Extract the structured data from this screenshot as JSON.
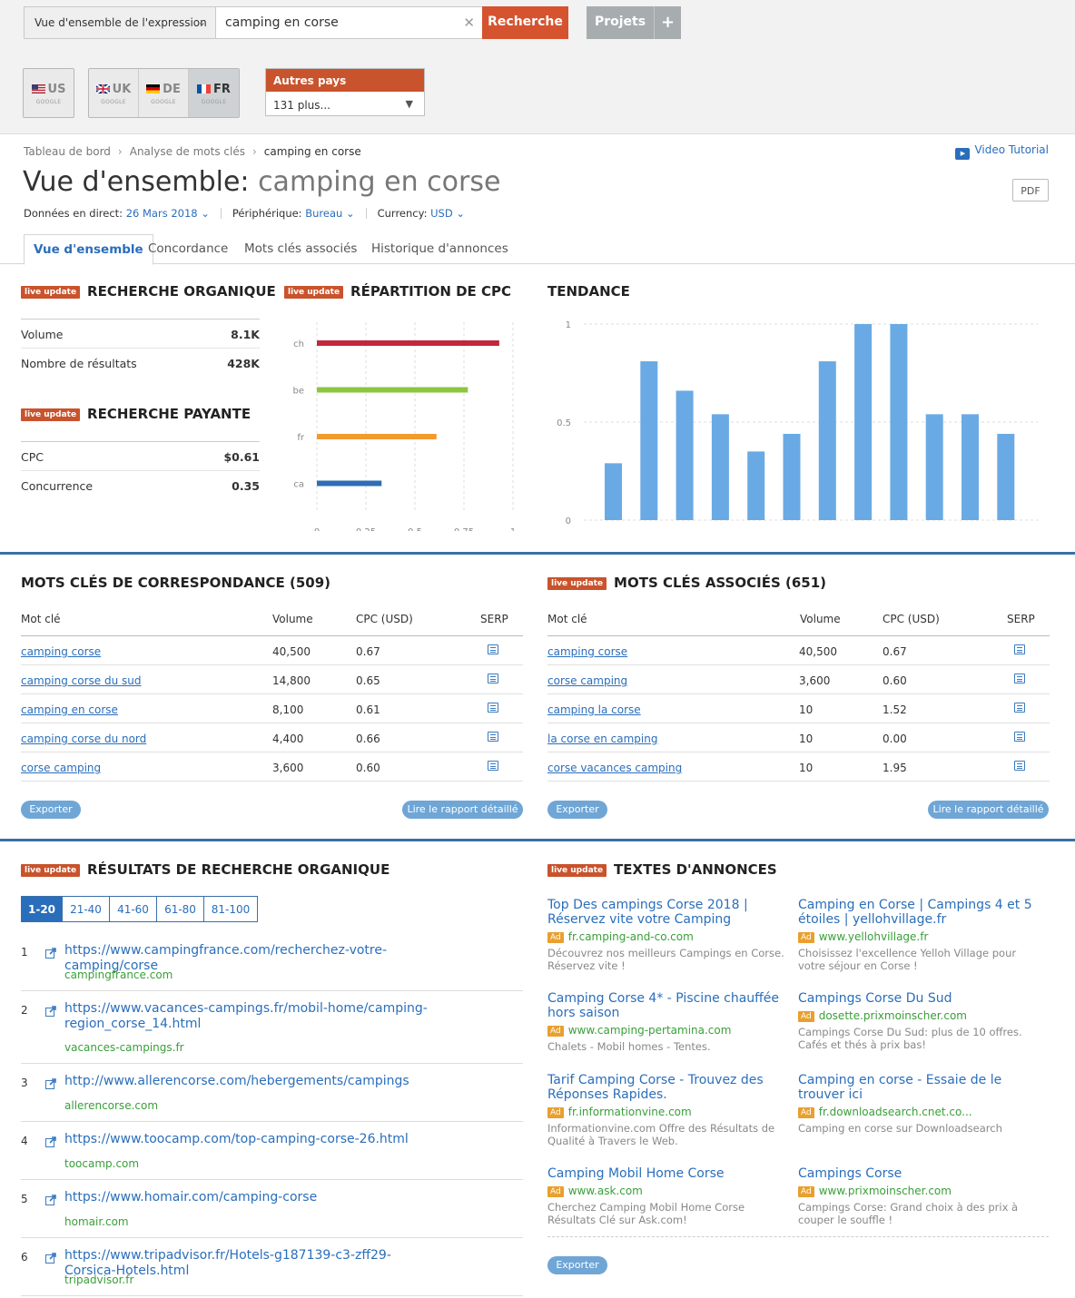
{
  "search": {
    "type_label": "Vue d'ensemble de l'expression",
    "query": "camping en corse",
    "search_btn": "Recherche",
    "projects_btn": "Projets",
    "add": "+"
  },
  "databases": {
    "us": "US",
    "uk": "UK",
    "de": "DE",
    "fr": "FR",
    "engine": "GOOGLE",
    "other_title": "Autres pays",
    "other_value": "131 plus..."
  },
  "breadcrumb": {
    "item1": "Tableau de bord",
    "item2": "Analyse de mots clés",
    "item3": "camping en corse"
  },
  "video_tutorial": "Video Tutorial",
  "page": {
    "title_prefix": "Vue d'ensemble:",
    "title_kw": "camping en corse",
    "pdf": "PDF"
  },
  "meta": {
    "live_label": "Données en direct:",
    "date": "26 Mars 2018",
    "device_label": "Périphérique:",
    "device": "Bureau",
    "currency_label": "Currency:",
    "currency": "USD"
  },
  "tabs": [
    "Vue d'ensemble",
    "Concordance",
    "Mots clés associés",
    "Historique d'annonces"
  ],
  "live_update": "live update",
  "organic": {
    "title": "RECHERCHE ORGANIQUE",
    "volume_label": "Volume",
    "volume": "8.1K",
    "results_label": "Nombre de résultats",
    "results": "428K"
  },
  "paid": {
    "title": "RECHERCHE PAYANTE",
    "cpc_label": "CPC",
    "cpc": "$0.61",
    "comp_label": "Concurrence",
    "comp": "0.35"
  },
  "cpc_dist": {
    "title": "RÉPARTITION DE CPC"
  },
  "trend": {
    "title": "TENDANCE"
  },
  "chart_data": [
    {
      "type": "bar",
      "orientation": "horizontal",
      "title": "RÉPARTITION DE CPC",
      "categories": [
        "ch",
        "be",
        "fr",
        "ca"
      ],
      "values": [
        0.93,
        0.77,
        0.61,
        0.33
      ],
      "colors": [
        "#c0283c",
        "#8cc63f",
        "#f39a2f",
        "#2f6db5"
      ],
      "xlim": [
        0,
        1
      ],
      "ticks": [
        "0",
        "0.25",
        "0.5",
        "0.75",
        "1"
      ]
    },
    {
      "type": "bar",
      "title": "TENDANCE",
      "values": [
        0.29,
        0.81,
        0.66,
        0.54,
        0.35,
        0.44,
        0.81,
        1.0,
        1.0,
        0.54,
        0.54,
        0.44
      ],
      "ylim": [
        0,
        1
      ],
      "ticks": [
        "1",
        "0.5",
        "0"
      ],
      "color": "#6aaae4"
    }
  ],
  "match": {
    "title": "MOTS CLÉS DE CORRESPONDANCE (509)",
    "cols": [
      "Mot clé",
      "Volume",
      "CPC (USD)",
      "SERP"
    ],
    "rows": [
      [
        "camping corse",
        "40,500",
        "0.67"
      ],
      [
        "camping corse du sud",
        "14,800",
        "0.65"
      ],
      [
        "camping en corse",
        "8,100",
        "0.61"
      ],
      [
        "camping corse du nord",
        "4,400",
        "0.66"
      ],
      [
        "corse camping",
        "3,600",
        "0.60"
      ]
    ],
    "export": "Exporter",
    "report": "Lire le rapport détaillé"
  },
  "related": {
    "title": "MOTS CLÉS ASSOCIÉS (651)",
    "cols": [
      "Mot clé",
      "Volume",
      "CPC (USD)",
      "SERP"
    ],
    "rows": [
      [
        "camping corse",
        "40,500",
        "0.67"
      ],
      [
        "corse camping",
        "3,600",
        "0.60"
      ],
      [
        "camping la corse",
        "10",
        "1.52"
      ],
      [
        "la corse en camping",
        "10",
        "0.00"
      ],
      [
        "corse vacances camping",
        "10",
        "1.95"
      ]
    ],
    "export": "Exporter",
    "report": "Lire le rapport détaillé"
  },
  "organic_results": {
    "title": "RÉSULTATS DE RECHERCHE ORGANIQUE",
    "pages": [
      "1-20",
      "21-40",
      "41-60",
      "61-80",
      "81-100"
    ],
    "items": [
      {
        "n": "1",
        "url": "https://www.campingfrance.com/recherchez-votre-camping/corse",
        "domain": "campingfrance.com"
      },
      {
        "n": "2",
        "url": "https://www.vacances-campings.fr/mobil-home/camping-region_corse_14.html",
        "domain": "vacances-campings.fr"
      },
      {
        "n": "3",
        "url": "http://www.allerencorse.com/hebergements/campings",
        "domain": "allerencorse.com"
      },
      {
        "n": "4",
        "url": "https://www.toocamp.com/top-camping-corse-26.html",
        "domain": "toocamp.com"
      },
      {
        "n": "5",
        "url": "https://www.homair.com/camping-corse",
        "domain": "homair.com"
      },
      {
        "n": "6",
        "url": "https://www.tripadvisor.fr/Hotels-g187139-c3-zff29-Corsica-Hotels.html",
        "domain": "tripadvisor.fr"
      }
    ]
  },
  "ads": {
    "title": "TEXTES D'ANNONCES",
    "tag": "Ad",
    "export": "Exporter",
    "items": [
      {
        "title": "Top Des campings Corse 2018 | Réservez vite votre Camping",
        "url": "fr.camping-and-co.com",
        "desc": "Découvrez nos meilleurs Campings en Corse. Réservez vite !"
      },
      {
        "title": "Camping en Corse | Campings 4 et 5 étoiles | yellohvillage.fr",
        "url": "www.yellohvillage.fr",
        "desc": "Choisissez l'excellence Yelloh Village pour votre séjour en Corse !"
      },
      {
        "title": "Camping Corse 4* - Piscine chauffée hors saison",
        "url": "www.camping-pertamina.com",
        "desc": "Chalets - Mobil homes - Tentes."
      },
      {
        "title": "Campings Corse Du Sud",
        "url": "dosette.prixmoinscher.com",
        "desc": "Campings Corse Du Sud: plus de 10 offres. Cafés et thés à prix bas!"
      },
      {
        "title": "Tarif Camping Corse - Trouvez des Réponses Rapides.",
        "url": "fr.informationvine.com",
        "desc": "Informationvine.com Offre des Résultats de Qualité à Travers le Web."
      },
      {
        "title": "Camping en corse - Essaie de le trouver ici",
        "url": "fr.downloadsearch.cnet.co...",
        "desc": "Camping en corse sur Downloadsearch"
      },
      {
        "title": "Camping Mobil Home Corse",
        "url": "www.ask.com",
        "desc": "Cherchez Camping Mobil Home Corse Résultats Clé sur Ask.com!"
      },
      {
        "title": "Campings Corse",
        "url": "www.prixmoinscher.com",
        "desc": "Campings Corse: Grand choix à des prix à couper le souffle !"
      }
    ]
  }
}
